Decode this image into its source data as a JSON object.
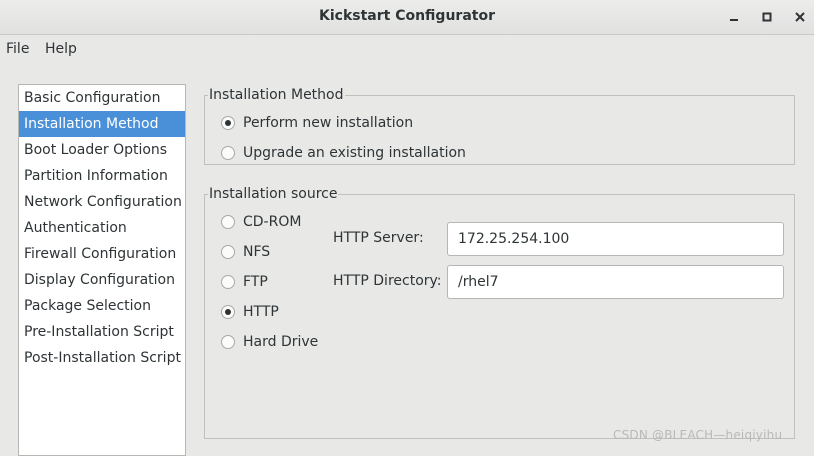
{
  "window": {
    "title": "Kickstart Configurator",
    "controls": [
      "minimize-icon",
      "maximize-icon",
      "close-icon"
    ]
  },
  "menubar": {
    "items": [
      "File",
      "Help"
    ]
  },
  "sidebar": {
    "selected": "Installation Method",
    "items": [
      "Basic Configuration",
      "Installation Method",
      "Boot Loader Options",
      "Partition Information",
      "Network Configuration",
      "Authentication",
      "Firewall Configuration",
      "Display Configuration",
      "Package Selection",
      "Pre-Installation Script",
      "Post-Installation Script"
    ]
  },
  "installation_method": {
    "title": "Installation Method",
    "options": [
      {
        "label": "Perform new installation",
        "checked": true
      },
      {
        "label": "Upgrade an existing installation",
        "checked": false
      }
    ]
  },
  "installation_source": {
    "title": "Installation source",
    "options": [
      {
        "label": "CD-ROM",
        "checked": false
      },
      {
        "label": "NFS",
        "checked": false
      },
      {
        "label": "FTP",
        "checked": false
      },
      {
        "label": "HTTP",
        "checked": true
      },
      {
        "label": "Hard Drive",
        "checked": false
      }
    ],
    "http_server": {
      "label": "HTTP Server:",
      "value": "172.25.254.100"
    },
    "http_directory": {
      "label": "HTTP Directory:",
      "value": "/rhel7"
    }
  },
  "watermark": "CSDN @BLEACH—heiqiyihu",
  "colors": {
    "selection": "#4a90d9",
    "background": "#e8e8e7"
  }
}
